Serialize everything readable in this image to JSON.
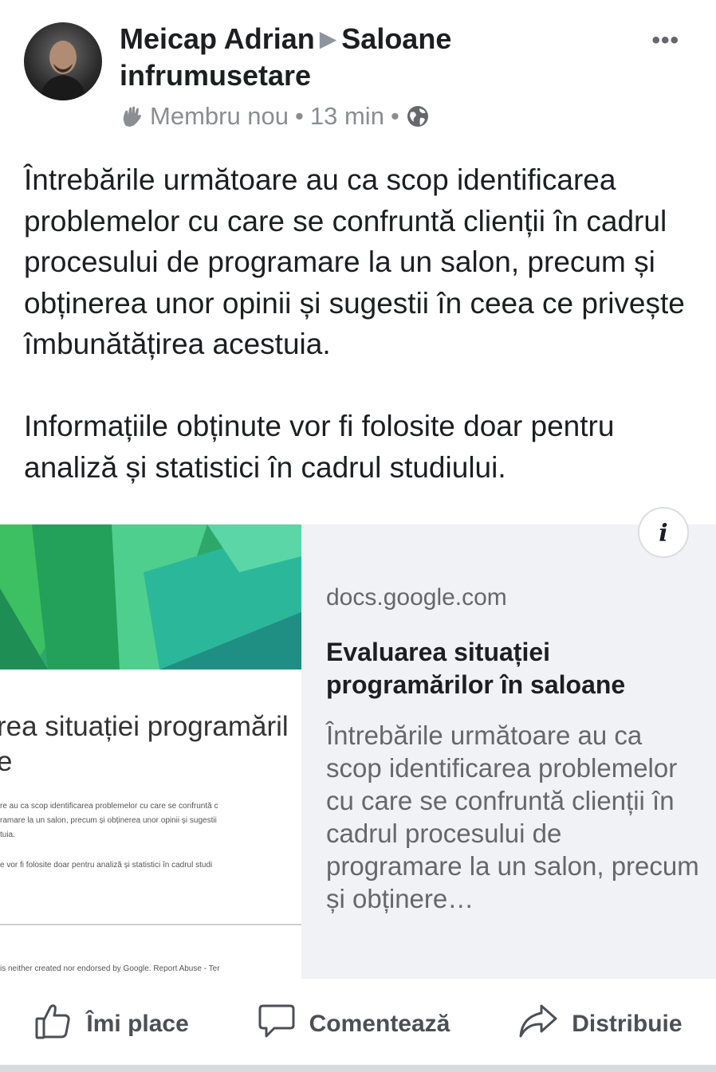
{
  "post": {
    "author": "Meicap Adrian",
    "group": "Saloane infrumusetare",
    "badge": "Membru nou",
    "time": "13 min",
    "privacy_icon": "globe-icon",
    "more_label": "•••",
    "paragraphs": [
      "Întrebările următoare au ca scop identificarea problemelor cu care se confruntă clienții în cadrul procesului de programare la un salon, precum și obținerea unor opinii și sugestii în ceea ce privește îmbunătățirea acestuia.",
      "Informațiile obținute vor fi folosite doar pentru analiză și statistici în cadrul studiului."
    ]
  },
  "link_preview": {
    "domain": "docs.google.com",
    "title": "Evaluarea situației programărilor în saloane",
    "description": "Întrebările următoare au ca scop identificarea problemelor cu care se confruntă clienții în cadrul procesului de programare la un salon, precum și obținere…",
    "info_label": "i",
    "thumbnail": {
      "form_title_line1": "rea situației programăril",
      "form_title_line2": "e",
      "small_lines": [
        "re au ca scop identificarea problemelor cu care se confruntă c",
        "ramare la un salon, precum și obținerea unor opinii și sugestii",
        "tuia.",
        "e vor fi folosite doar pentru analiză și statistici în cadrul studi"
      ],
      "footer": "is neither created nor endorsed by Google. Report Abuse - Ter"
    }
  },
  "actions": {
    "like": "Îmi place",
    "comment": "Comentează",
    "share": "Distribuie"
  },
  "colors": {
    "card_bg": "#f0f2f5",
    "muted": "#65676b",
    "text": "#1c1e21"
  }
}
